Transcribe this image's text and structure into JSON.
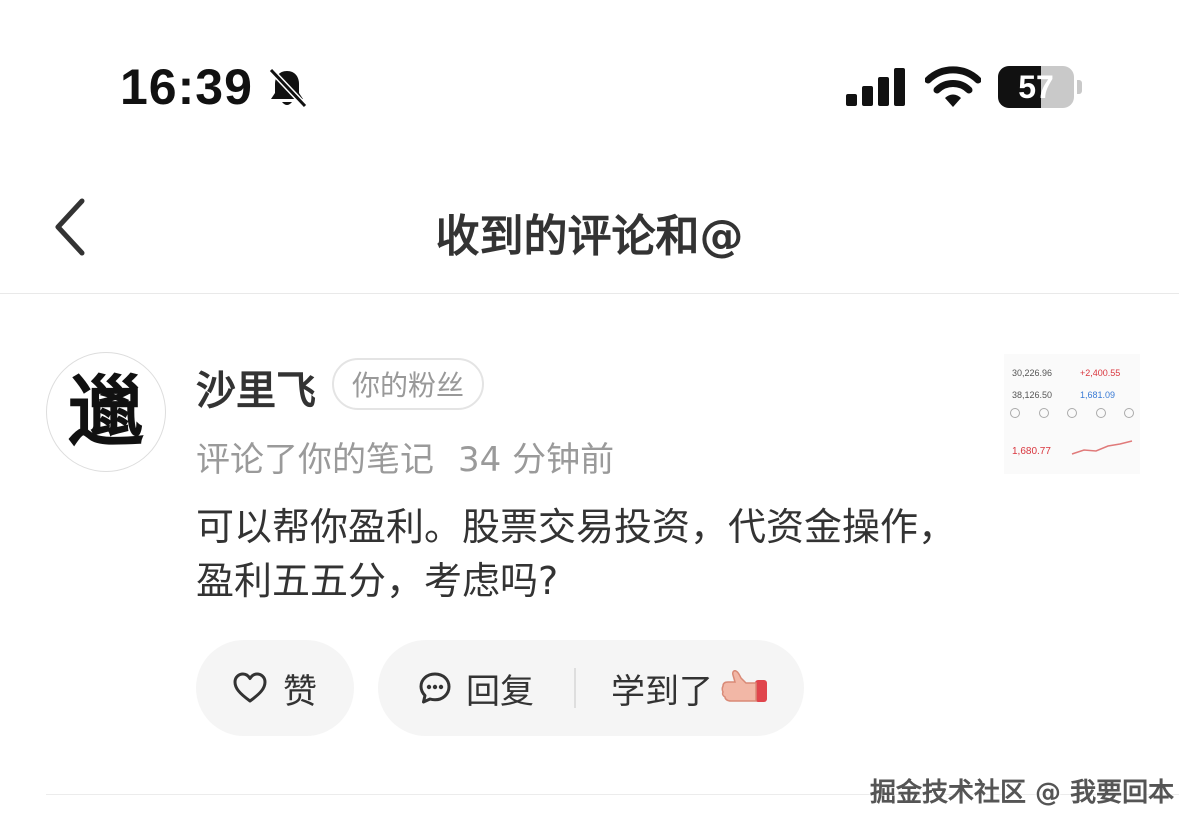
{
  "status_bar": {
    "time": "16:39",
    "battery_level": "57",
    "battery_fraction": 0.57,
    "icons": [
      "bell-muted-icon",
      "cellular-signal-icon",
      "wifi-icon",
      "battery-icon"
    ]
  },
  "nav": {
    "back_icon": "chevron-left-icon",
    "title": "收到的评论和@"
  },
  "comment": {
    "avatar_glyph": "邋",
    "username": "沙里飞",
    "badge": "你的粉丝",
    "action_text": "评论了你的笔记",
    "time_ago": "34 分钟前",
    "body": "可以帮你盈利。股票交易投资，代资金操作，盈利五五分，考虑吗?",
    "actions": {
      "like_label": "赞",
      "like_icon": "heart-outline-icon",
      "reply_label": "回复",
      "reply_icon": "chat-bubble-icon",
      "learned_label": "学到了",
      "learned_icon": "thumbs-up-emoji-icon"
    },
    "thumbnail": {
      "values": [
        "30,226.96",
        "+2,400.55",
        "38,126.50",
        "1,681.09",
        "1,680.77"
      ],
      "colors": {
        "negative": "#d9363e",
        "positive": "#3a7bd5"
      }
    }
  },
  "watermark": "掘金技术社区 @ 我要回本",
  "colors": {
    "background": "#ffffff",
    "title_text": "#333333",
    "secondary_text": "#9a9a9a",
    "pill_background": "#f5f5f5"
  }
}
